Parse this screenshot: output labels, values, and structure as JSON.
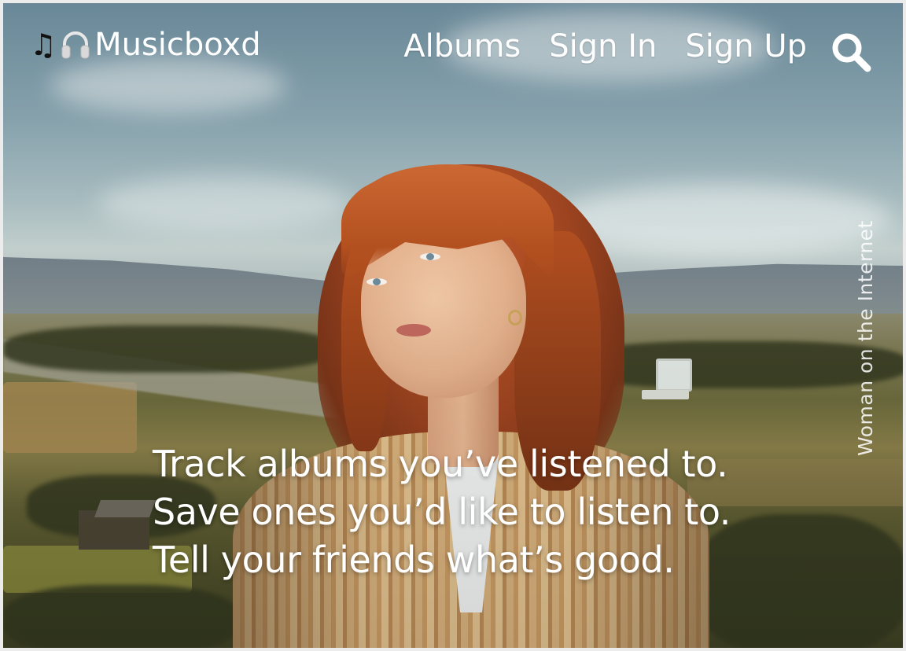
{
  "header": {
    "brand_icons": [
      "music-note-icon",
      "headphones-icon"
    ],
    "brand_name": "Musicboxd",
    "nav": [
      {
        "label": "Albums"
      },
      {
        "label": "Sign In"
      },
      {
        "label": "Sign Up"
      }
    ],
    "search_icon": "search-icon"
  },
  "hero": {
    "image_caption": "Woman on the Internet",
    "tagline": [
      "Track albums you’ve listened to.",
      "Save ones you’d like to listen to.",
      "Tell your friends what’s good."
    ]
  },
  "colors": {
    "nav_text": "#ffffff",
    "sky": "#8aa6b1",
    "hair": "#b3501f",
    "jacket": "#d6b07c"
  }
}
